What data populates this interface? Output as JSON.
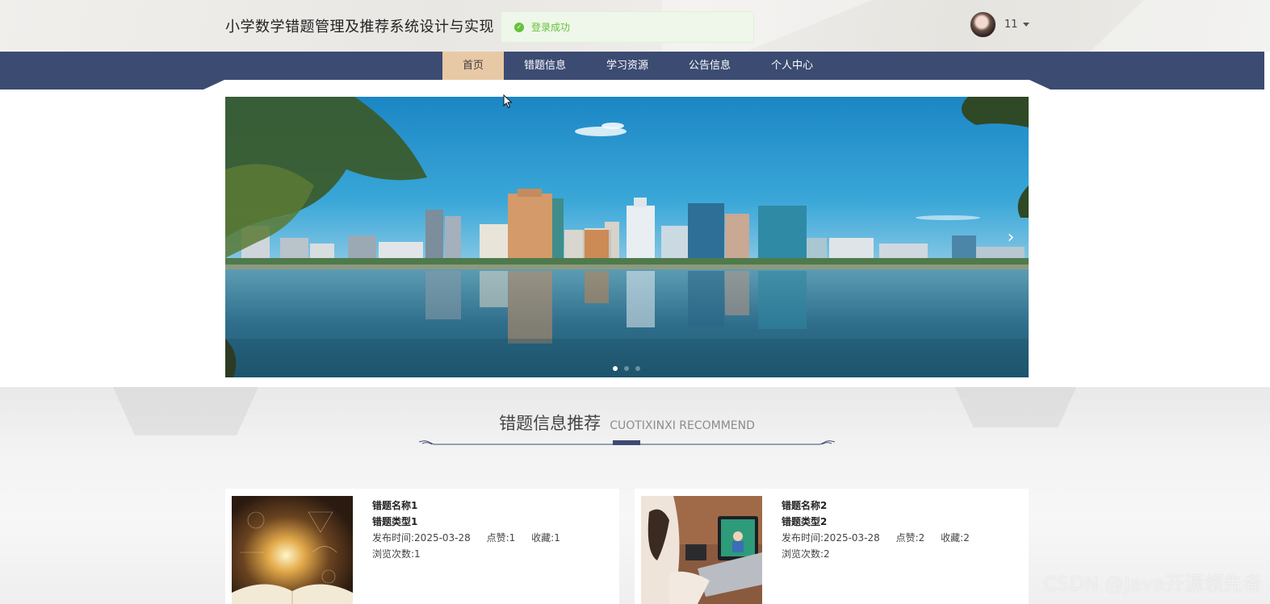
{
  "header": {
    "site_title": "小学数学错题管理及推荐系统设计与实现",
    "toast": "登录成功",
    "username": "11"
  },
  "nav": {
    "tabs": [
      {
        "label": "首页",
        "active": true
      },
      {
        "label": "错题信息",
        "active": false
      },
      {
        "label": "学习资源",
        "active": false
      },
      {
        "label": "公告信息",
        "active": false
      },
      {
        "label": "个人中心",
        "active": false
      }
    ]
  },
  "carousel": {
    "next_icon": "chevron-right-icon",
    "slide_count": 3,
    "active_slide": 1
  },
  "section": {
    "title": "错题信息推荐",
    "subtitle": "CUOTIXINXI RECOMMEND"
  },
  "cards": [
    {
      "name": "错题名称1",
      "type": "错题类型1",
      "publish_label": "发布时间:",
      "publish_date": "2025-03-28",
      "like_label": "点赞:",
      "likes": "1",
      "fav_label": "收藏:",
      "favs": "1",
      "views_label": "浏览次数:",
      "views": "1"
    },
    {
      "name": "错题名称2",
      "type": "错题类型2",
      "publish_label": "发布时间:",
      "publish_date": "2025-03-28",
      "like_label": "点赞:",
      "likes": "2",
      "fav_label": "收藏:",
      "favs": "2",
      "views_label": "浏览次数:",
      "views": "2"
    }
  ],
  "watermark": "CSDN @Java开源领先者",
  "colors": {
    "nav_bg": "#3c4b72",
    "nav_active": "#e8c9a5",
    "success": "#67c23a"
  }
}
